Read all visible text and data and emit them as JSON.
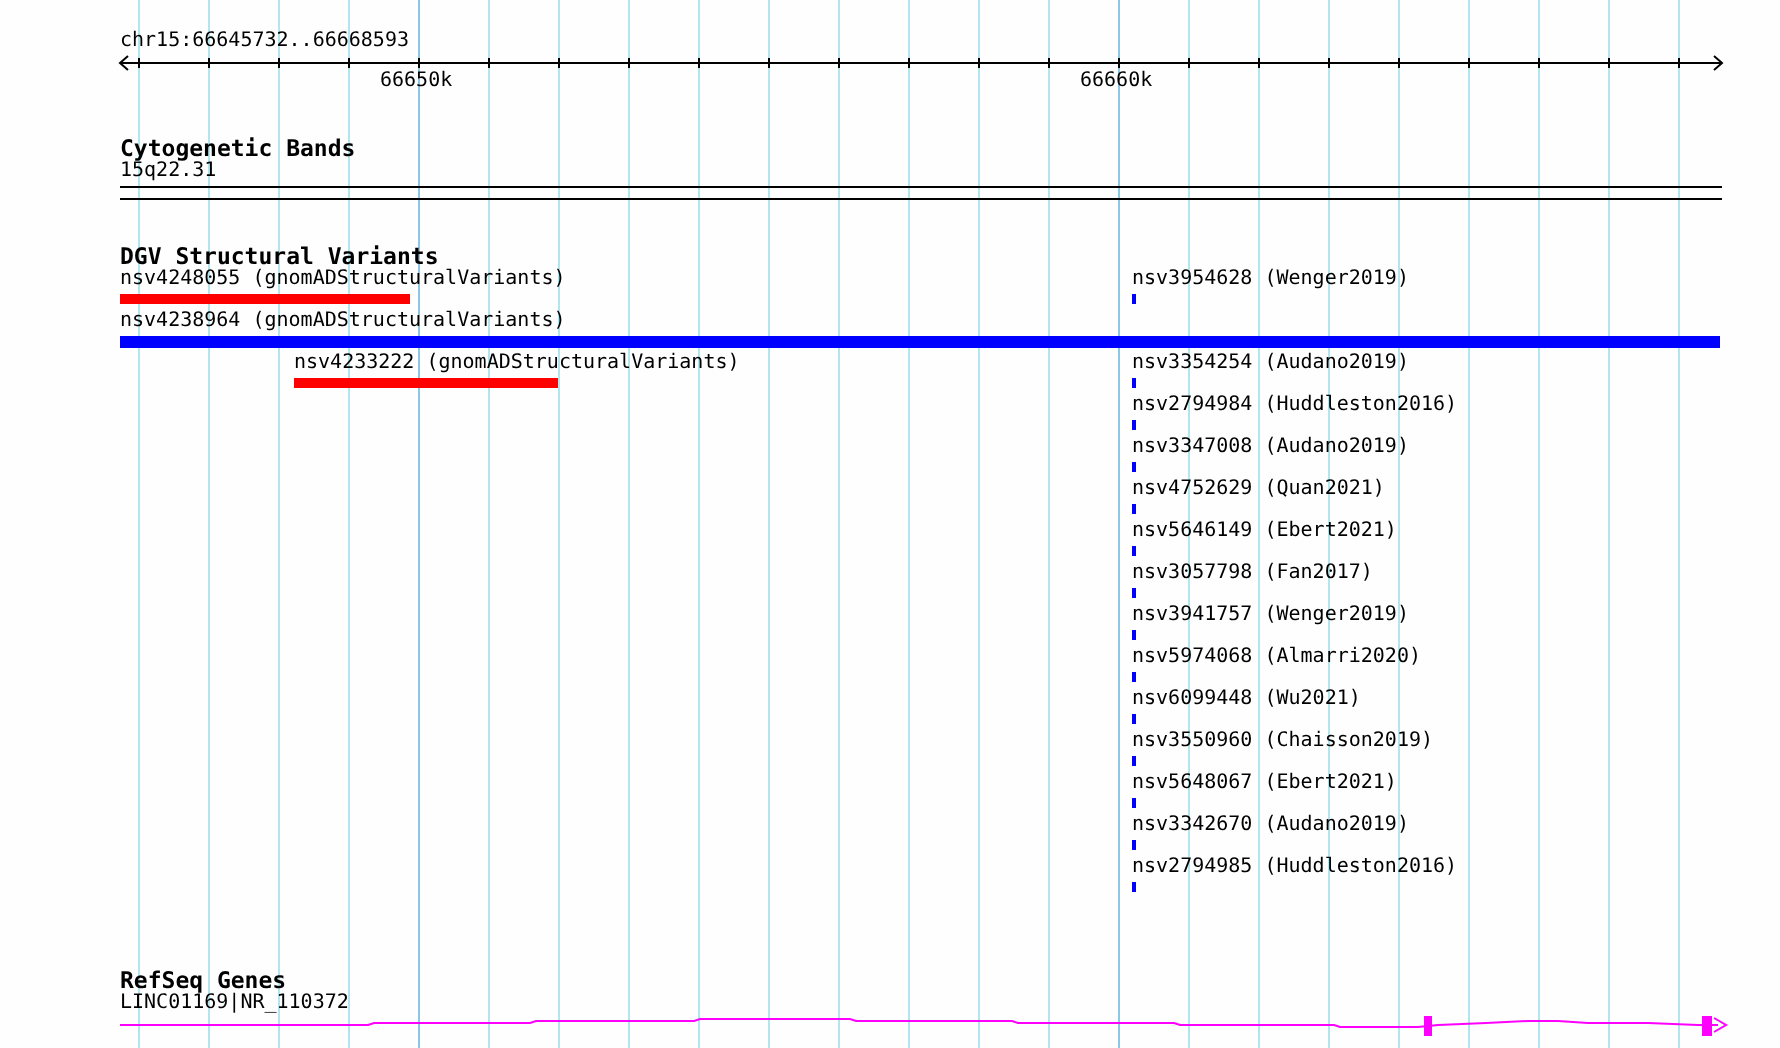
{
  "ruler": {
    "location": "chr15:66645732..66668593",
    "ticks": [
      "66650k",
      "66660k"
    ]
  },
  "tracks": [
    {
      "title": "Cytogenetic Bands",
      "kind": "bands",
      "features": [
        {
          "label": "15q22.31"
        }
      ]
    },
    {
      "title": "DGV Structural Variants",
      "kind": "variants",
      "features": [
        {
          "label": "nsv4248055 (gnomADStructuralVariants)",
          "color": "#ff0000"
        },
        {
          "label": "nsv4238964 (gnomADStructuralVariants)",
          "color": "#0000ff"
        },
        {
          "label": "nsv4233222 (gnomADStructuralVariants)",
          "color": "#ff0000"
        },
        {
          "label": "nsv3954628 (Wenger2019)",
          "color": "#0000ff"
        },
        {
          "label": "nsv3354254 (Audano2019)",
          "color": "#0000ff"
        },
        {
          "label": "nsv2794984 (Huddleston2016)",
          "color": "#0000ff"
        },
        {
          "label": "nsv3347008 (Audano2019)",
          "color": "#0000ff"
        },
        {
          "label": "nsv4752629 (Quan2021)",
          "color": "#0000ff"
        },
        {
          "label": "nsv5646149 (Ebert2021)",
          "color": "#0000ff"
        },
        {
          "label": "nsv3057798 (Fan2017)",
          "color": "#0000ff"
        },
        {
          "label": "nsv3941757 (Wenger2019)",
          "color": "#0000ff"
        },
        {
          "label": "nsv5974068 (Almarri2020)",
          "color": "#0000ff"
        },
        {
          "label": "nsv6099448 (Wu2021)",
          "color": "#0000ff"
        },
        {
          "label": "nsv3550960 (Chaisson2019)",
          "color": "#0000ff"
        },
        {
          "label": "nsv5648067 (Ebert2021)",
          "color": "#0000ff"
        },
        {
          "label": "nsv3342670 (Audano2019)",
          "color": "#0000ff"
        },
        {
          "label": "nsv2794985 (Huddleston2016)",
          "color": "#0000ff"
        }
      ]
    },
    {
      "title": "RefSeq Genes",
      "kind": "genes",
      "features": [
        {
          "label": "LINC01169|NR_110372"
        }
      ]
    }
  ]
}
